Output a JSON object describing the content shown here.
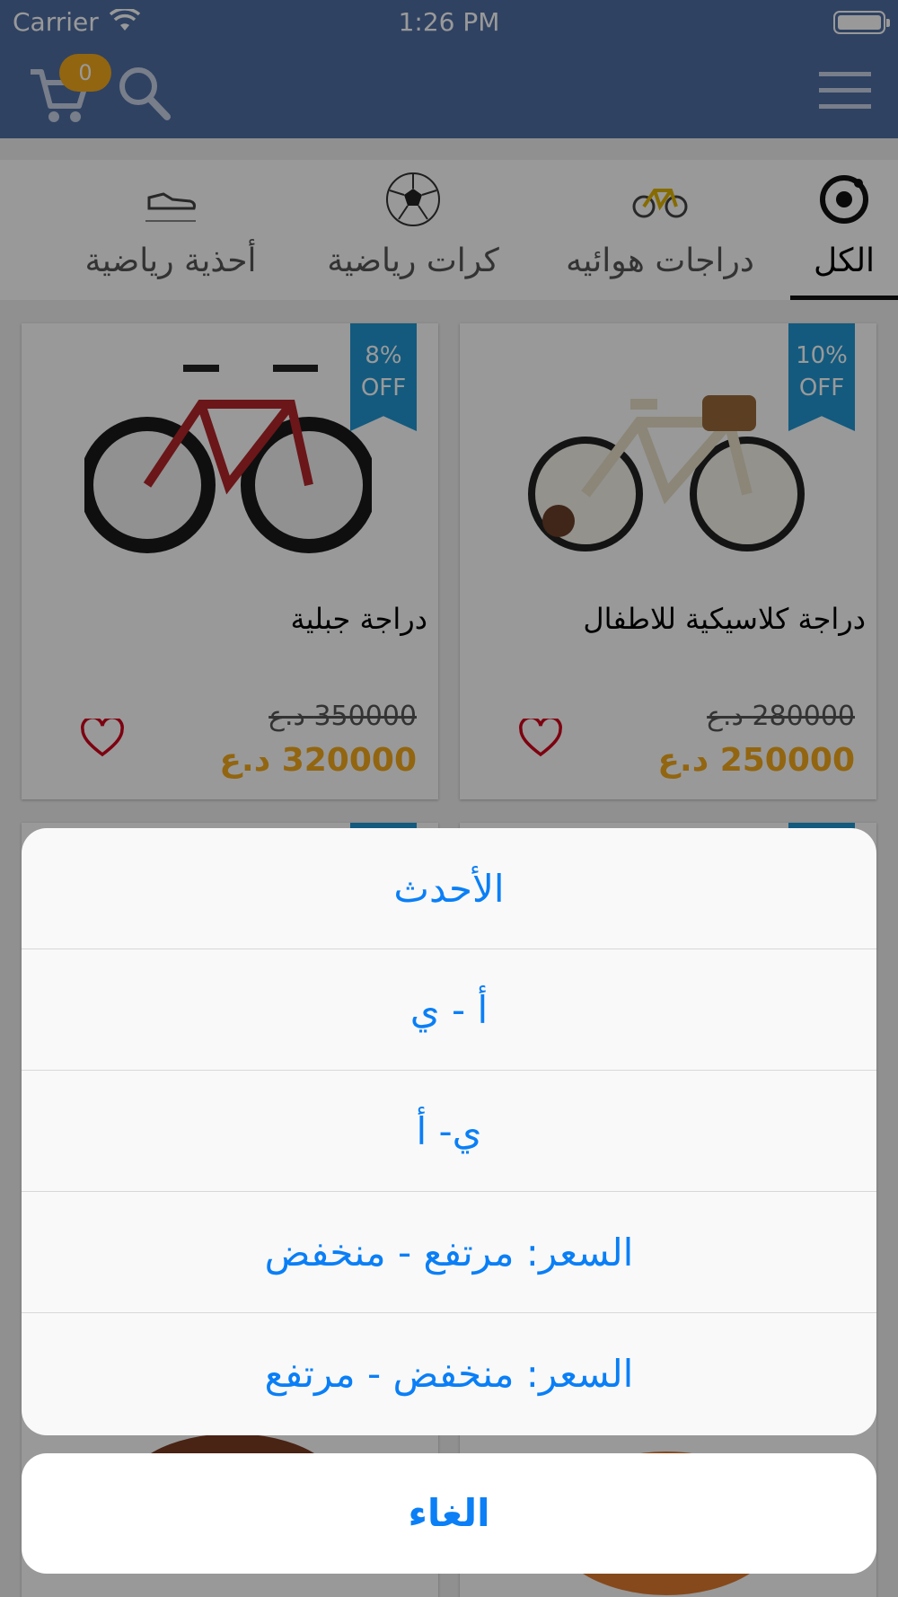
{
  "status": {
    "carrier": "Carrier",
    "time": "1:26 PM"
  },
  "header": {
    "cart_count": "0"
  },
  "tabs": [
    {
      "label": "الكل",
      "icon": "all-icon"
    },
    {
      "label": "دراجات هوائيه",
      "icon": "bicycle-icon"
    },
    {
      "label": "كرات رياضية",
      "icon": "soccer-ball-icon"
    },
    {
      "label": "أحذية رياضية",
      "icon": "shoe-icon"
    }
  ],
  "products": [
    {
      "name": "دراجة كلاسيكية للاطفال",
      "discount_pct": "10%",
      "discount_off": "OFF",
      "old_price": "280000 د.ع",
      "new_price": "250000 د.ع"
    },
    {
      "name": "دراجة جبلية",
      "discount_pct": "8%",
      "discount_off": "OFF",
      "old_price": "350000 د.ع",
      "new_price": "320000 د.ع"
    }
  ],
  "sort_sheet": {
    "options": [
      "الأحدث",
      "أ - ي",
      "ي- أ",
      "السعر: مرتفع - منخفض",
      "السعر: منخفض - مرتفع"
    ],
    "cancel": "الغاء"
  },
  "colors": {
    "header": "#4f6ea3",
    "accent": "#f3a81c",
    "ribbon": "#2196d3",
    "action": "#0a7ff6"
  }
}
